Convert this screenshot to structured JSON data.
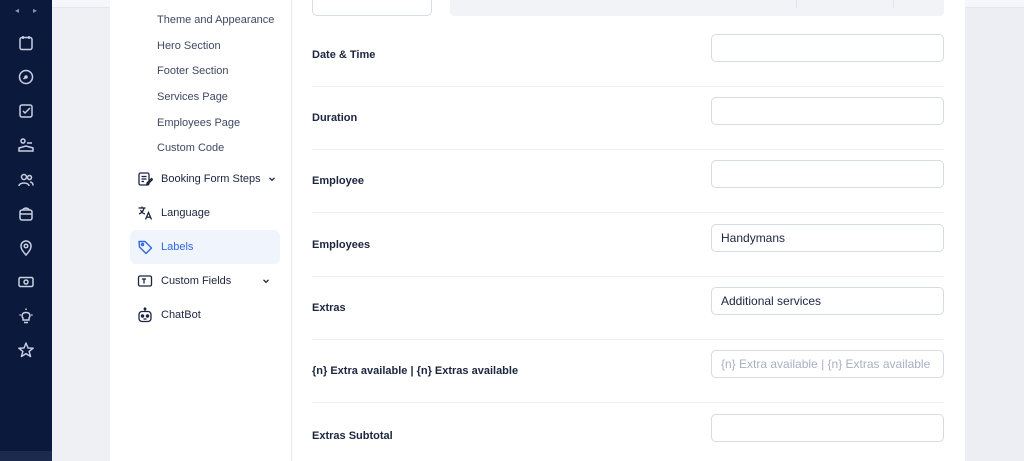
{
  "rail": {
    "arrow_left": "◂",
    "arrow_right": "▸",
    "icons": [
      "calendar-icon",
      "dashboard-icon",
      "check-square-icon",
      "booking-icon",
      "users-icon",
      "services-icon",
      "location-icon",
      "money-icon",
      "lightbulb-icon",
      "star-icon"
    ]
  },
  "nav": {
    "sub_items": [
      {
        "label": "Theme and Appearance"
      },
      {
        "label": "Hero Section"
      },
      {
        "label": "Footer Section"
      },
      {
        "label": "Services Page"
      },
      {
        "label": "Employees Page"
      },
      {
        "label": "Custom Code"
      }
    ],
    "items": [
      {
        "label": "Booking Form Steps",
        "icon": "form-steps-icon",
        "expandable": true
      },
      {
        "label": "Language",
        "icon": "language-icon",
        "expandable": false
      },
      {
        "label": "Labels",
        "icon": "tag-icon",
        "expandable": false,
        "active": true
      },
      {
        "label": "Custom Fields",
        "icon": "custom-fields-icon",
        "expandable": true
      },
      {
        "label": "ChatBot",
        "icon": "robot-icon",
        "expandable": false
      }
    ]
  },
  "labels": {
    "rows": [
      {
        "label": "Date & Time",
        "value": "",
        "placeholder": ""
      },
      {
        "label": "Duration",
        "value": "",
        "placeholder": ""
      },
      {
        "label": "Employee",
        "value": "",
        "placeholder": ""
      },
      {
        "label": "Employees",
        "value": "Handymans",
        "placeholder": ""
      },
      {
        "label": "Extras",
        "value": "Additional services",
        "placeholder": ""
      },
      {
        "label": "{n} Extra available | {n} Extras available",
        "value": "",
        "placeholder": "{n} Extra available | {n} Extras available"
      },
      {
        "label": "Extras Subtotal",
        "value": "",
        "placeholder": ""
      }
    ]
  },
  "colors": {
    "rail_bg": "#0b1a3c",
    "accent": "#2f66e0",
    "active_bg": "#f0f4fc"
  }
}
